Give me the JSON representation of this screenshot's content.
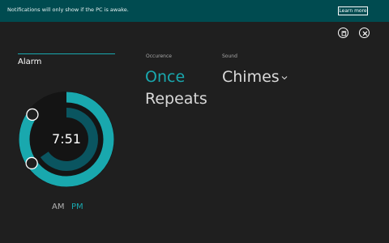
{
  "banner": {
    "message": "Notifications will only show if the PC is awake.",
    "learn_more": "Learn more"
  },
  "toolbar": {
    "save_icon": "save-icon",
    "close_icon": "close-icon"
  },
  "alarm": {
    "title": "Alarm",
    "time": "7:51",
    "hour": 7,
    "minute": 51,
    "am_label": "AM",
    "pm_label": "PM",
    "selected_period": "PM"
  },
  "occurrence": {
    "label": "Occurence",
    "options": [
      "Once",
      "Repeats"
    ],
    "selected": "Once"
  },
  "sound": {
    "label": "Sound",
    "value": "Chimes"
  },
  "colors": {
    "background": "#1f1f1f",
    "banner": "#004b50",
    "accent": "#19a8ae",
    "inner_ring": "#0a5560"
  }
}
